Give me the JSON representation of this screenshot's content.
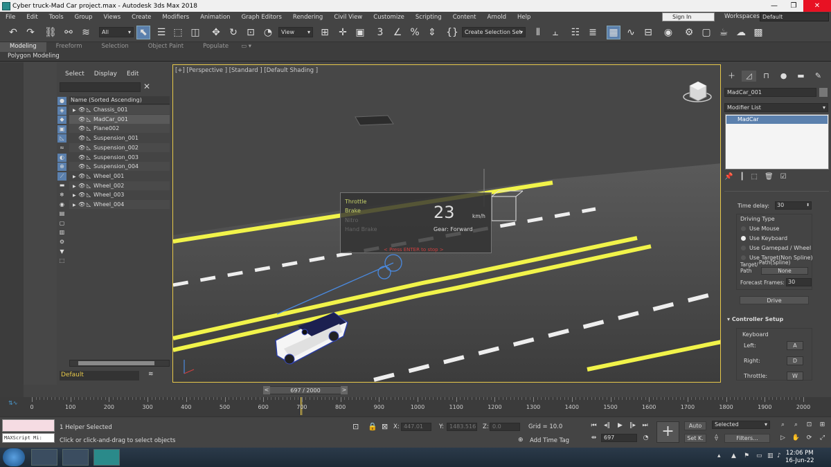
{
  "window": {
    "title": "Cyber truck-Mad Car project.max - Autodesk 3ds Max 2018"
  },
  "menubar": {
    "items": [
      "File",
      "Edit",
      "Tools",
      "Group",
      "Views",
      "Create",
      "Modifiers",
      "Animation",
      "Graph Editors",
      "Rendering",
      "Civil View",
      "Customize",
      "Scripting",
      "Content",
      "Arnold",
      "Help"
    ],
    "signin": "Sign In",
    "workspace_label": "Workspaces:",
    "workspace_value": "Default"
  },
  "toolbar": {
    "selection_filter": "All",
    "ref_coord": "View",
    "named_selection": "Create Selection Set"
  },
  "ribbon": {
    "tabs": [
      "Modeling",
      "Freeform",
      "Selection",
      "Object Paint",
      "Populate"
    ],
    "panel": "Polygon Modeling"
  },
  "explorer": {
    "menu": [
      "Select",
      "Display",
      "Edit"
    ],
    "column_header": "Name (Sorted Ascending)",
    "layer": "Default",
    "objects": [
      {
        "name": "Chassis_001",
        "expand": true
      },
      {
        "name": "MadCar_001",
        "expand": false
      },
      {
        "name": "Plane002",
        "expand": false
      },
      {
        "name": "Suspension_001",
        "expand": false
      },
      {
        "name": "Suspension_002",
        "expand": false
      },
      {
        "name": "Suspension_003",
        "expand": false
      },
      {
        "name": "Suspension_004",
        "expand": false
      },
      {
        "name": "Wheel_001",
        "expand": true
      },
      {
        "name": "Wheel_002",
        "expand": true
      },
      {
        "name": "Wheel_003",
        "expand": true
      },
      {
        "name": "Wheel_004",
        "expand": true
      }
    ],
    "selected_index": 1
  },
  "viewport": {
    "label": "[+] [Perspective ] [Standard ] [Default Shading ]"
  },
  "hud": {
    "throttle": "Throttle",
    "brake": "Brake",
    "nitro": "Nitro",
    "handbrake": "Hand Brake",
    "speed": "23",
    "unit": "km/h",
    "gear": "Gear: Forward",
    "prompt": "< Press ENTER to stop >"
  },
  "command_panel": {
    "object_name": "MadCar_001",
    "modifier_list": "Modifier List",
    "stack_item": "MadCar",
    "time_delay_label": "Time delay:",
    "time_delay": "30",
    "driving_type_label": "Driving Type",
    "driving_options": [
      "Use Mouse",
      "Use Keyboard",
      "Use Gamepad / Wheel",
      "Use Target(Non Spline)"
    ],
    "driving_selected": 1,
    "target_path_label": "Target/\nPath",
    "path_spline_label": "Path(Spline)",
    "path_value": "None",
    "forecast_label": "Forecast Frames:",
    "forecast_value": "30",
    "drive_button": "Drive",
    "controller_setup": "Controller Setup",
    "keyboard_label": "Keyboard",
    "keys": [
      {
        "label": "Left:",
        "key": "A"
      },
      {
        "label": "Right:",
        "key": "D"
      },
      {
        "label": "Throttle:",
        "key": "W"
      }
    ]
  },
  "timeslider": {
    "frame_display": "697 / 2000",
    "prev": "<",
    "next": ">"
  },
  "trackbar": {
    "labels": [
      "0",
      "100",
      "200",
      "300",
      "400",
      "500",
      "600",
      "700",
      "800",
      "900",
      "1000",
      "1100",
      "1200",
      "1300",
      "1400",
      "1500",
      "1600",
      "1700",
      "1800",
      "1900",
      "2000"
    ]
  },
  "status": {
    "selected": "1 Helper Selected",
    "prompt": "Click or click-and-drag to select objects",
    "maxscript": "MAXScript Mi:",
    "x_label": "X:",
    "x": "447.01",
    "y_label": "Y:",
    "y": "1483.516",
    "z_label": "Z:",
    "z": "0.0",
    "grid": "Grid = 10.0",
    "add_time_tag": "Add Time Tag",
    "frame": "697",
    "auto": "Auto",
    "setk": "Set K.",
    "key_mode": "Selected",
    "filters": "Filters..."
  },
  "taskbar": {
    "time": "12:06 PM",
    "date": "16-Jun-22"
  },
  "colors": {
    "accent": "#5b80ad",
    "viewport_border": "#e8c94a",
    "road_line": "#f1f34a",
    "hud_text_active": "#c7d36a"
  }
}
